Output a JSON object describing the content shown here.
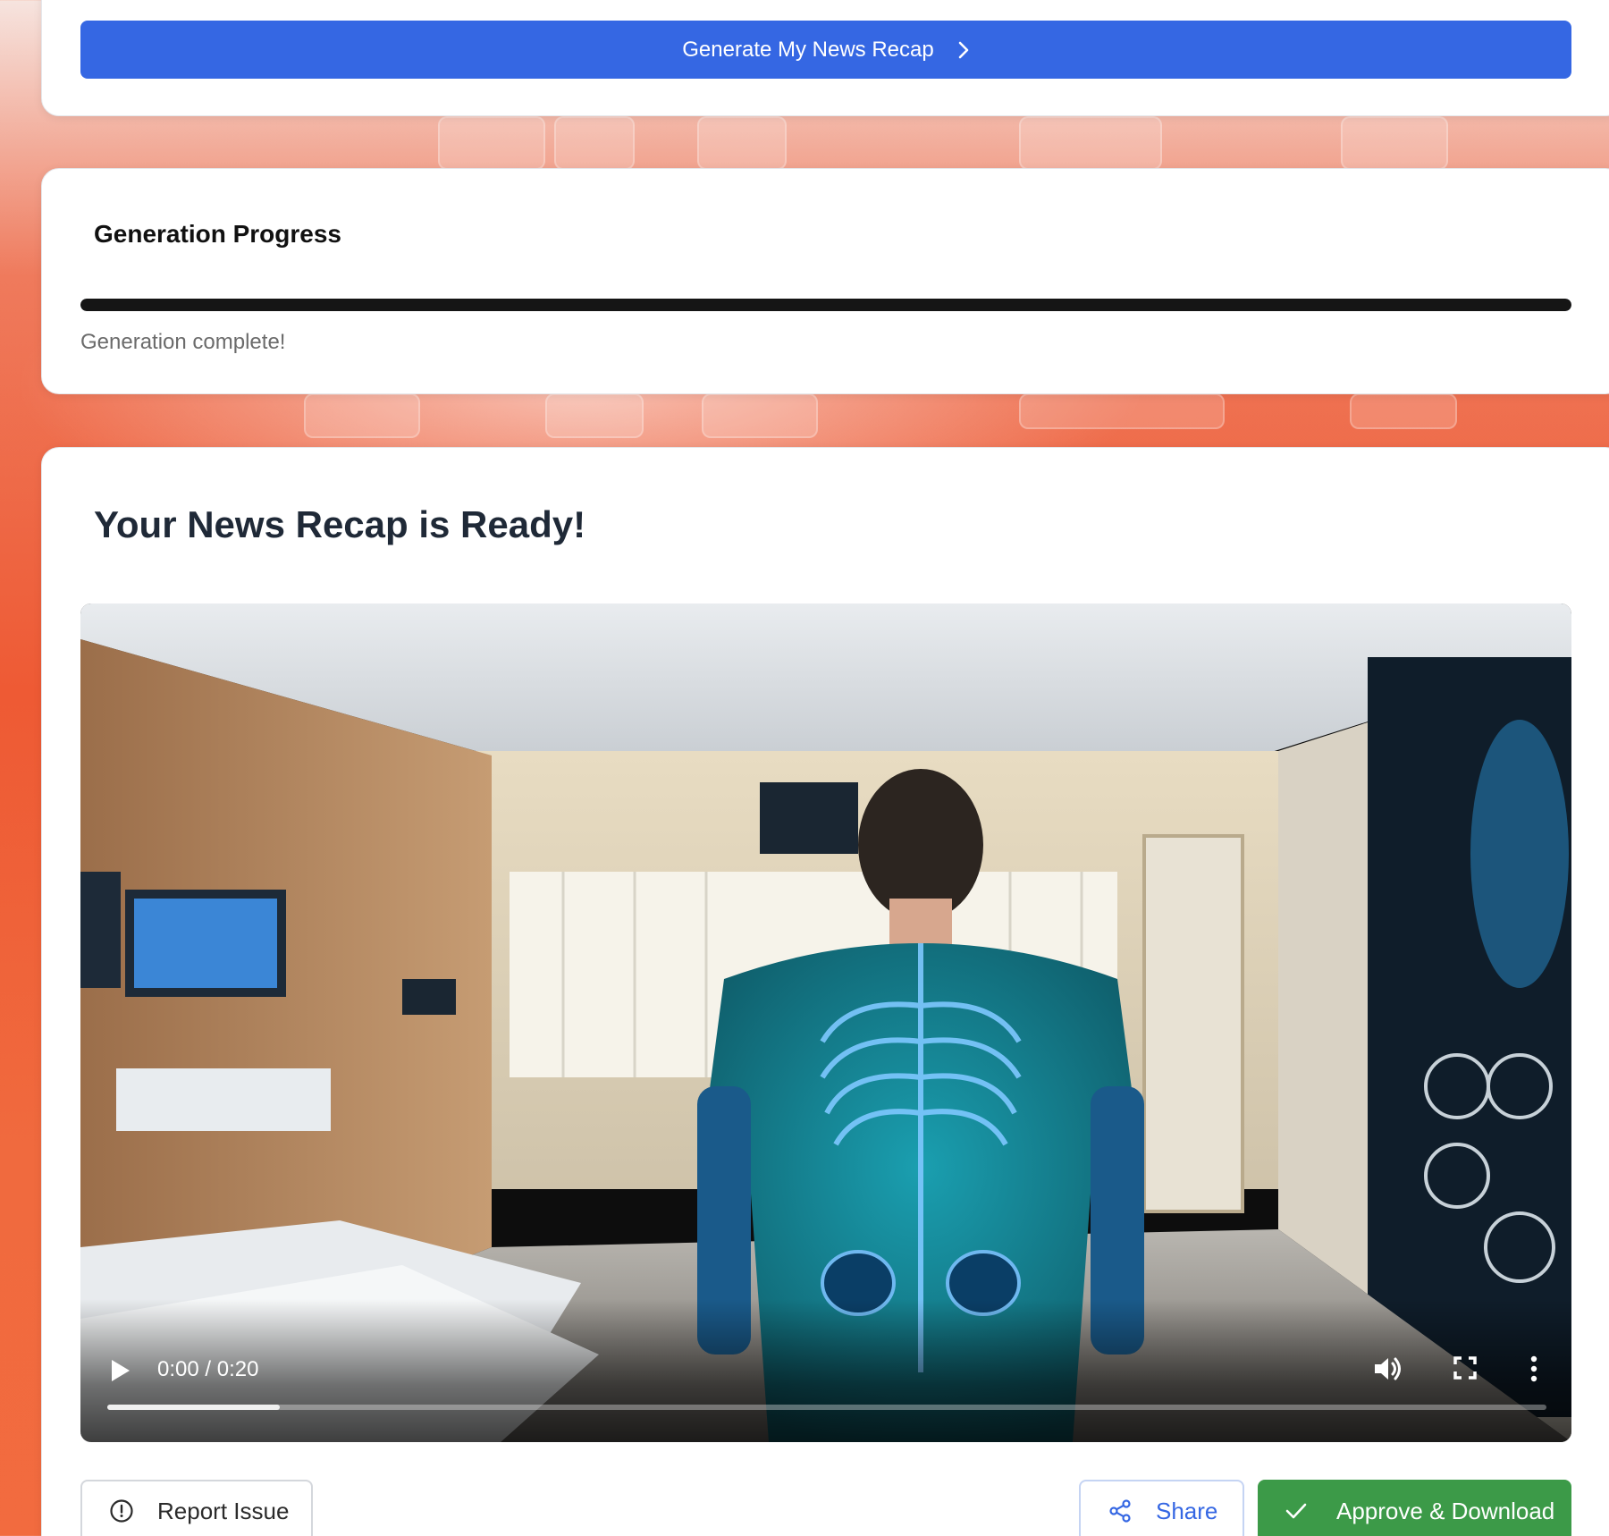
{
  "generate": {
    "button_label": "Generate My News Recap",
    "icon": "chevron-right-icon"
  },
  "progress": {
    "title": "Generation Progress",
    "value_percent": 100,
    "status": "Generation complete!"
  },
  "result": {
    "title": "Your News Recap is Ready!",
    "video": {
      "time": "0:00 / 0:20",
      "played_fraction": 0.12,
      "controls": [
        "play-icon",
        "volume-icon",
        "fullscreen-icon",
        "more-options-icon"
      ]
    }
  },
  "actions": {
    "report_label": "Report Issue",
    "share_label": "Share",
    "approve_label": "Approve & Download"
  },
  "colors": {
    "primary": "#3567e3",
    "success": "#3c9a48",
    "progress_fill": "#151515",
    "background_accent": "#ee5a34"
  }
}
